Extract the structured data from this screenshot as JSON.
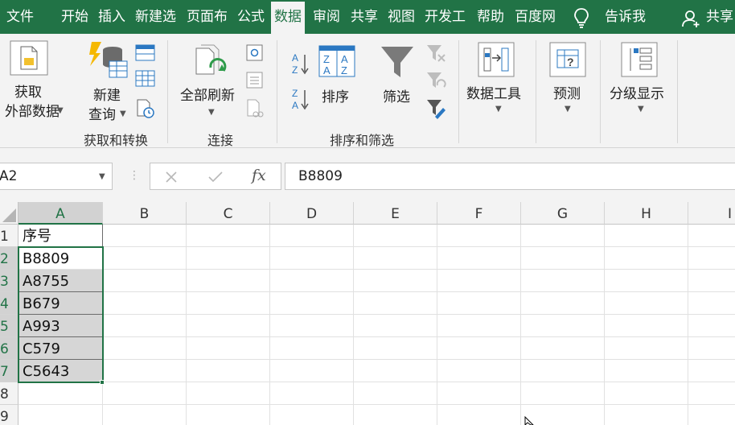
{
  "tabs": [
    {
      "label": "文件",
      "active": false
    },
    {
      "label": "开始",
      "active": false
    },
    {
      "label": "插入",
      "active": false
    },
    {
      "label": "新建选",
      "active": false
    },
    {
      "label": "页面布",
      "active": false
    },
    {
      "label": "公式",
      "active": false
    },
    {
      "label": "数据",
      "active": true
    },
    {
      "label": "审阅",
      "active": false
    },
    {
      "label": "共享",
      "active": false
    },
    {
      "label": "视图",
      "active": false
    },
    {
      "label": "开发工",
      "active": false
    },
    {
      "label": "帮助",
      "active": false
    },
    {
      "label": "百度网",
      "active": false
    }
  ],
  "tellme": {
    "label": "告诉我",
    "icon": "lightbulb-icon"
  },
  "share": {
    "label": "共享",
    "icon": "person-add-icon"
  },
  "ribbon": {
    "get_data": {
      "line1": "获取",
      "line2": "外部数据"
    },
    "new_query": {
      "line1": "新建",
      "line2": "查询"
    },
    "refresh_all": {
      "label": "全部刷新"
    },
    "sort": {
      "label": "排序"
    },
    "filter": {
      "label": "筛选"
    },
    "data_tools": {
      "label": "数据工具"
    },
    "forecast": {
      "label": "预测"
    },
    "outline": {
      "label": "分级显示"
    },
    "groups": {
      "get_transform": "获取和转换",
      "connections": "连接",
      "sort_filter": "排序和筛选"
    }
  },
  "formula_bar": {
    "name_box": "A2",
    "fx": "fx",
    "value": "B8809"
  },
  "sheet": {
    "columns": [
      "A",
      "B",
      "C",
      "D",
      "E",
      "F",
      "G",
      "H",
      "I"
    ],
    "rows": [
      "1",
      "2",
      "3",
      "4",
      "5",
      "6",
      "7",
      "8",
      "9"
    ],
    "cells_a": [
      "序号",
      "B8809",
      "A8755",
      "B679",
      "A993",
      "C579",
      "C5643",
      "",
      ""
    ]
  },
  "colors": {
    "accent": "#217346",
    "selection": "#d6d6d6"
  }
}
